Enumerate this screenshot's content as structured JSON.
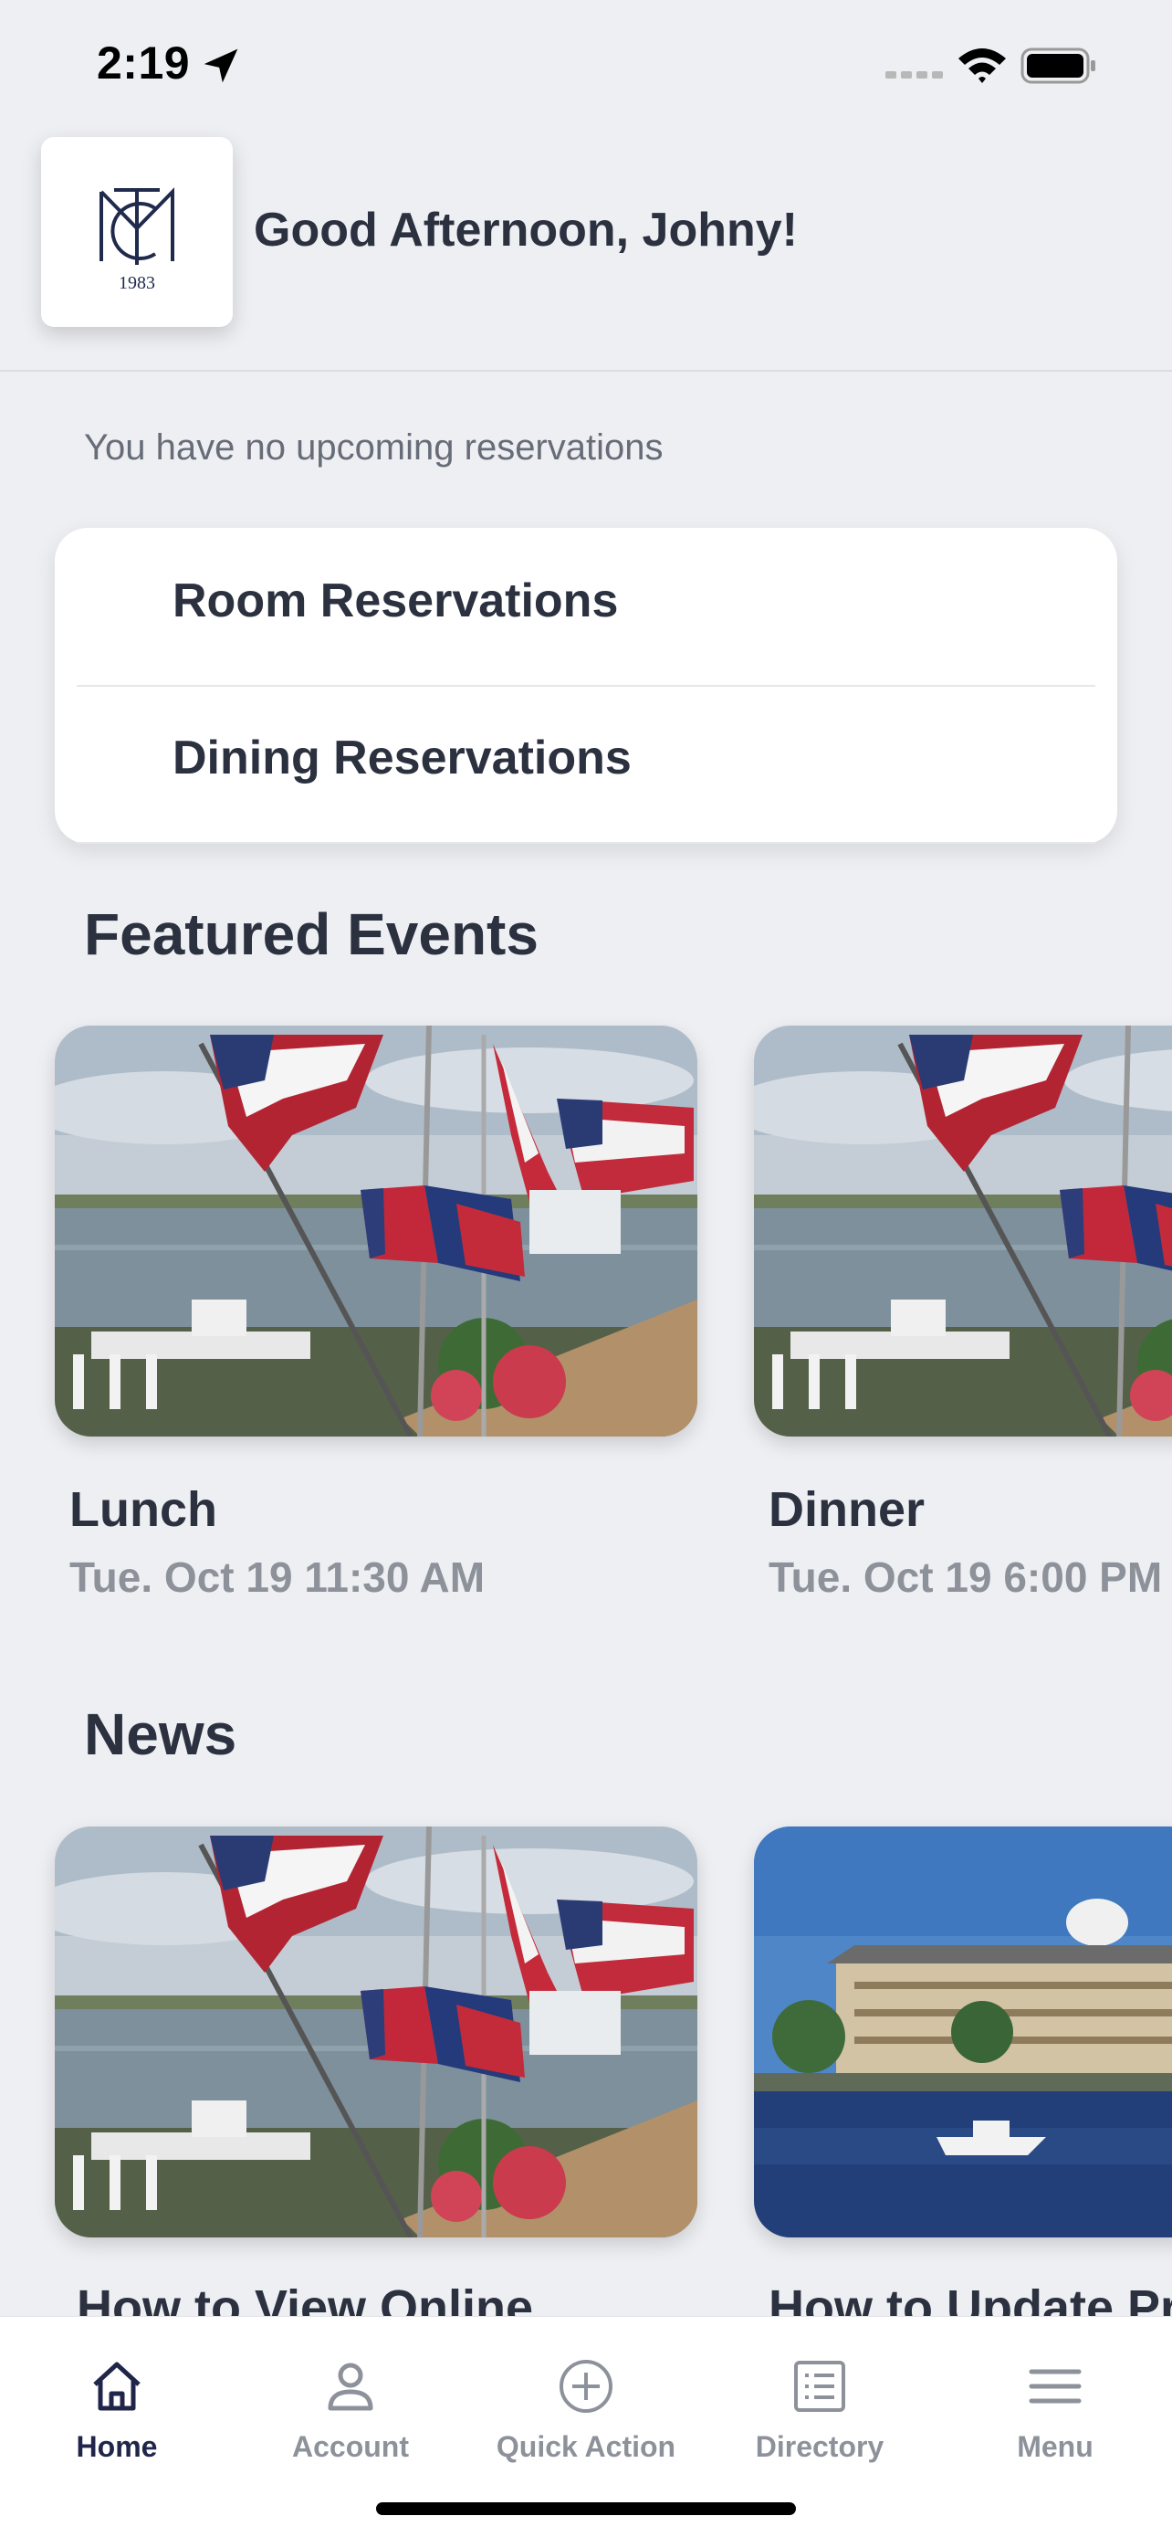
{
  "status_bar": {
    "time": "2:19",
    "icons": [
      "location-arrow-icon",
      "cellular-signal-icon",
      "wifi-icon",
      "battery-icon"
    ]
  },
  "header": {
    "logo_text": "1983",
    "greeting": "Good Afternoon, Johny!"
  },
  "reservations": {
    "status_text": "You have no upcoming reservations",
    "items": [
      {
        "label": "Room Reservations"
      },
      {
        "label": "Dining Reservations"
      }
    ]
  },
  "featured_events": {
    "title": "Featured Events",
    "items": [
      {
        "title": "Lunch",
        "datetime": "Tue. Oct 19 11:30 AM",
        "image": "flags-marina-photo"
      },
      {
        "title": "Dinner",
        "datetime": "Tue. Oct 19 6:00 PM",
        "image": "flags-marina-photo"
      }
    ]
  },
  "news": {
    "title": "News",
    "items": [
      {
        "title": "How to View Online",
        "image": "flags-marina-photo"
      },
      {
        "title": "How to Update Pr",
        "image": "clubhouse-water-photo"
      }
    ]
  },
  "tab_bar": {
    "active": "Home",
    "tabs": [
      {
        "label": "Home",
        "icon": "home-icon"
      },
      {
        "label": "Account",
        "icon": "account-icon"
      },
      {
        "label": "Quick Action",
        "icon": "plus-circle-icon"
      },
      {
        "label": "Directory",
        "icon": "directory-list-icon"
      },
      {
        "label": "Menu",
        "icon": "hamburger-menu-icon"
      }
    ]
  },
  "colors": {
    "background": "#eeeff3",
    "text_primary": "#2c3140",
    "text_secondary": "#8d929a",
    "tab_active": "#20264a",
    "logo_navy": "#1f2a4d"
  }
}
